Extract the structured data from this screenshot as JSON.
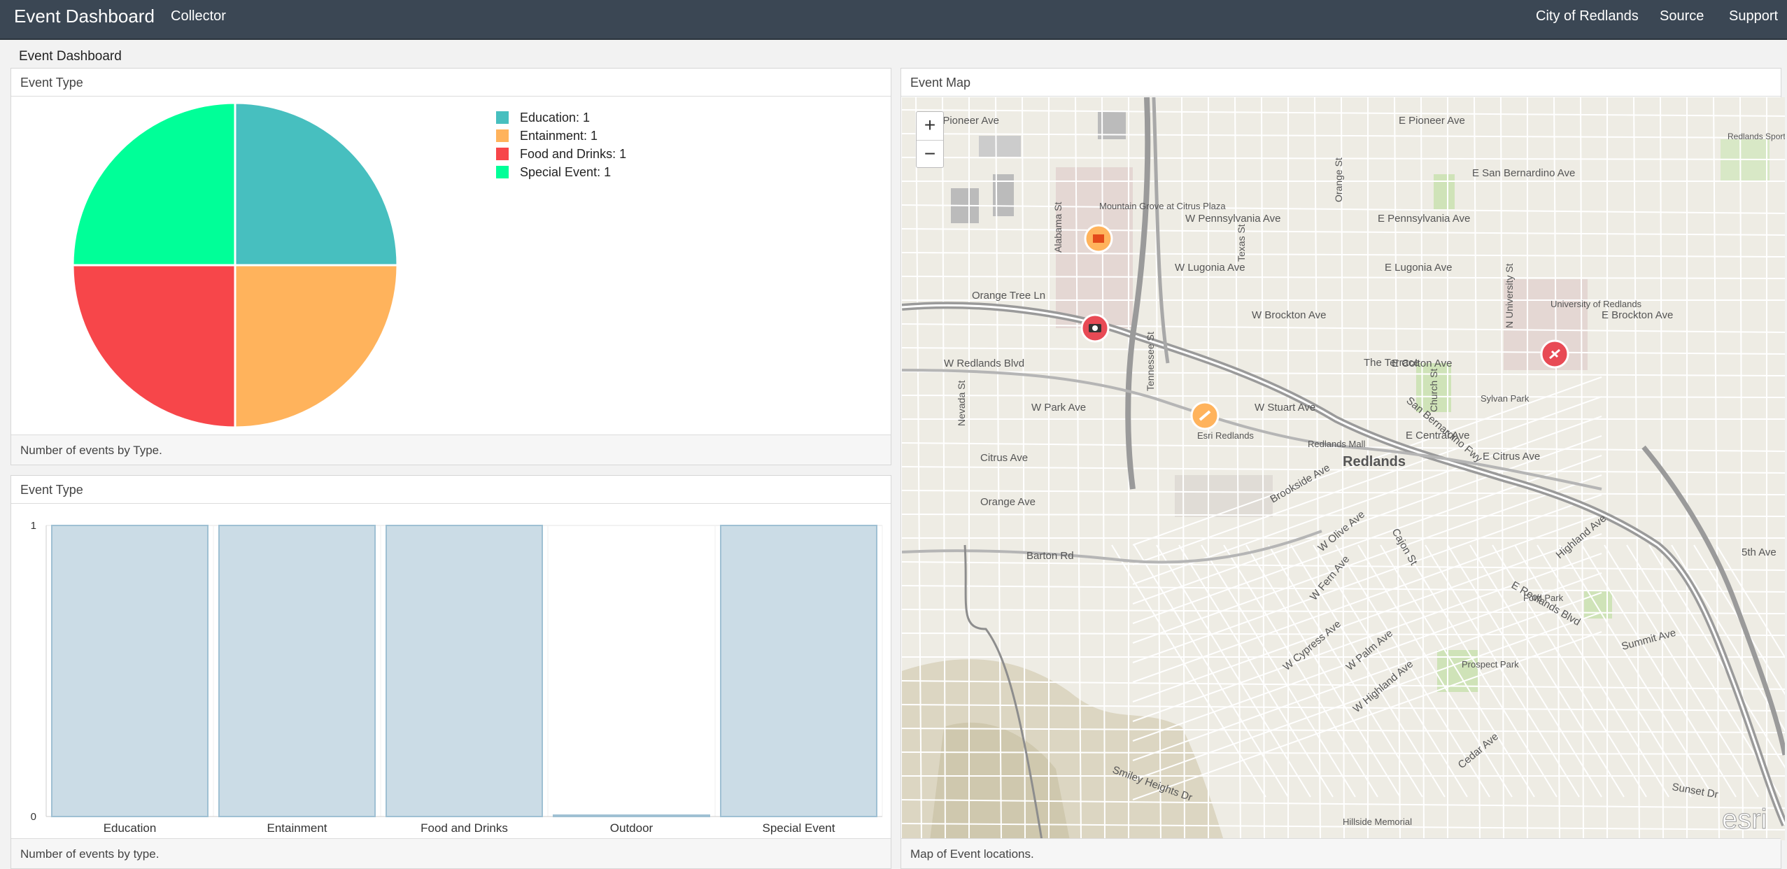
{
  "navbar": {
    "brand": "Event Dashboard",
    "collector": "Collector",
    "right_links": [
      "City of Redlands",
      "Source",
      "Support"
    ]
  },
  "page_title": "Event Dashboard",
  "pie_panel": {
    "title": "Event Type",
    "footer": "Number of events by Type.",
    "legend": [
      {
        "label": "Education: 1",
        "color": "#47bfbf"
      },
      {
        "label": "Entainment: 1",
        "color": "#ffb35c"
      },
      {
        "label": "Food and Drinks: 1",
        "color": "#f7464a"
      },
      {
        "label": "Special Event: 1",
        "color": "#00ff98"
      }
    ]
  },
  "bar_panel": {
    "title": "Event Type",
    "footer": "Number of events by type."
  },
  "map_panel": {
    "title": "Event Map",
    "footer": "Map of Event locations.",
    "zoom_in": "+",
    "zoom_out": "−",
    "attribution": "esri",
    "city_label": "Redlands",
    "street_labels": [
      "W Pioneer Ave",
      "E Pioneer Ave",
      "W Pennsylvania Ave",
      "E Pennsylvania Ave",
      "W Lugonia Ave",
      "E Lugonia Ave",
      "Orange Tree Ln",
      "W Brockton Ave",
      "E Brockton Ave",
      "W Redlands Blvd",
      "E Colton Ave",
      "W Stuart Ave",
      "W Park Ave",
      "E Central Ave",
      "Citrus Ave",
      "E Citrus Ave",
      "Orange Ave",
      "Barton Rd",
      "The Terrace",
      "San Bernardino Fwy",
      "E San Bernardino Ave",
      "Highland Ave",
      "E Redlands Blvd",
      "Brookside Ave",
      "W Olive Ave",
      "W Fern Ave",
      "W Cypress Ave",
      "W Palm Ave",
      "W Highland Ave",
      "Cajon St",
      "Texas St",
      "Nevada St",
      "Alabama St",
      "Tennessee St",
      "Orange St",
      "Church St",
      "N University St",
      "Summit Ave",
      "5th Ave",
      "Mountain Grove at Citrus Plaza",
      "University of Redlands",
      "Esri Redlands",
      "Redlands Mall",
      "Prospect Park",
      "Ford Park",
      "Sylvan Park",
      "Redlands Sports Park",
      "Hillside Memorial",
      "Smiley Heights Dr",
      "Cedar Ave",
      "Sunset Dr"
    ]
  },
  "chart_data": [
    {
      "type": "pie",
      "title": "",
      "categories": [
        "Education",
        "Entainment",
        "Food and Drinks",
        "Special Event"
      ],
      "values": [
        1,
        1,
        1,
        1
      ],
      "colors": [
        "#47bfbf",
        "#ffb35c",
        "#f7464a",
        "#00ff98"
      ],
      "legend_position": "right"
    },
    {
      "type": "bar",
      "title": "",
      "categories": [
        "Education",
        "Entainment",
        "Food and Drinks",
        "Outdoor",
        "Special Event"
      ],
      "values": [
        1,
        1,
        1,
        0,
        1
      ],
      "ylim": [
        0,
        1
      ],
      "yticks": [
        "0",
        "1"
      ],
      "bar_color": "#cbdce6",
      "bar_border": "#9fc0d3",
      "grid": true
    }
  ]
}
